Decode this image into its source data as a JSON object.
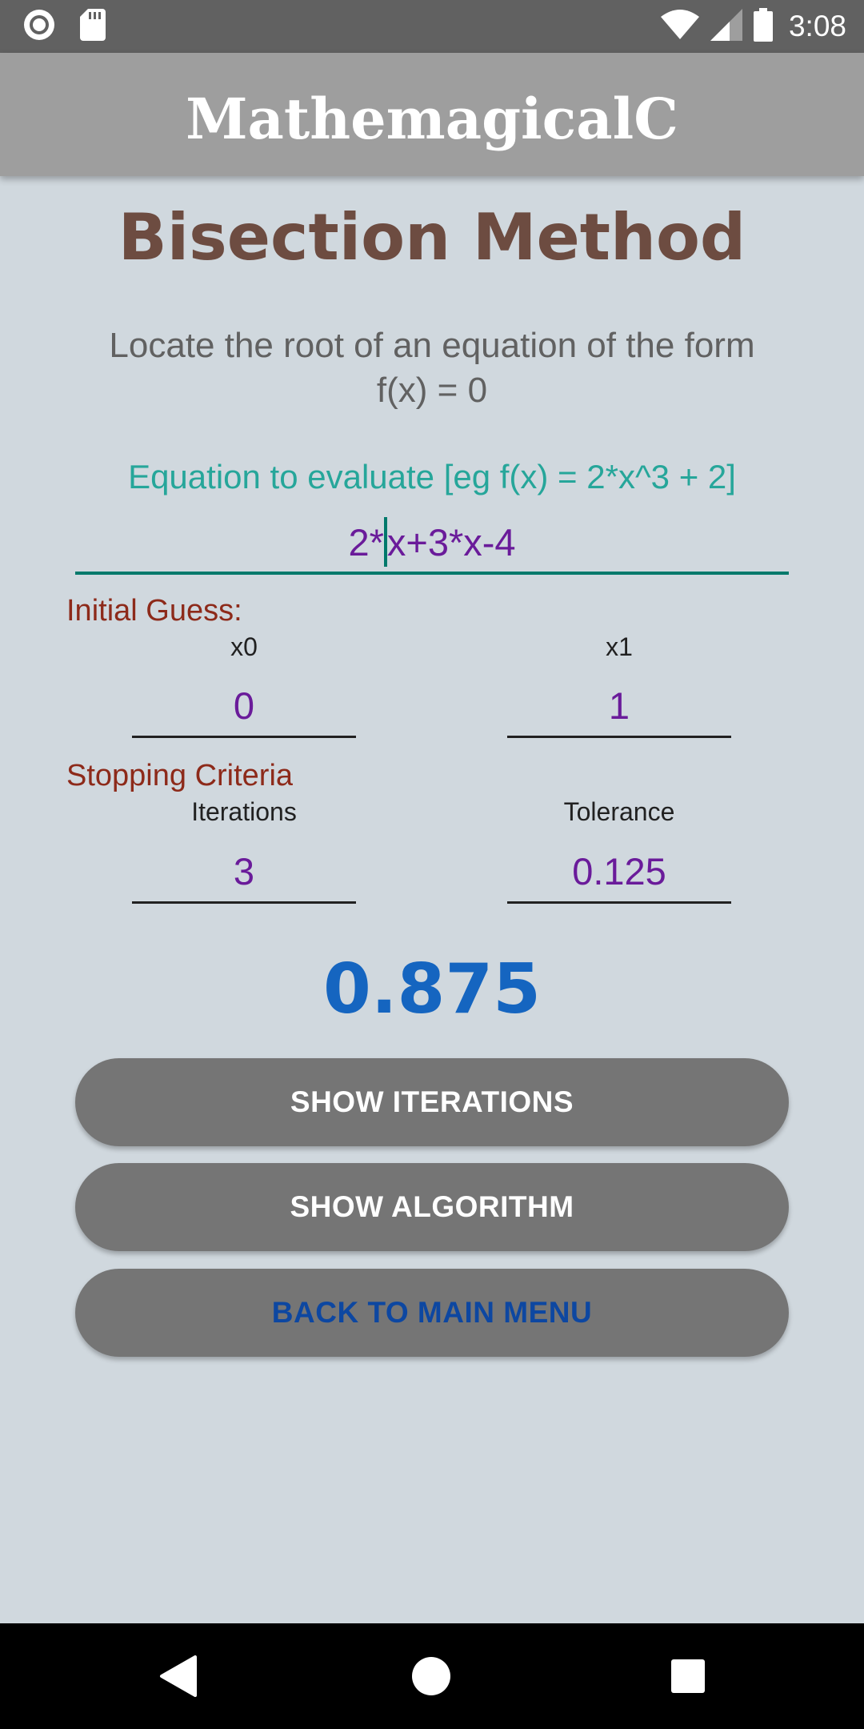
{
  "status_bar": {
    "time": "3:08",
    "icons": [
      "record-icon",
      "sd-card-icon",
      "wifi-icon",
      "signal-icon",
      "battery-icon"
    ]
  },
  "app_bar": {
    "title": "MathemagicalC"
  },
  "main": {
    "title": "Bisection Method",
    "subtitle": "Locate the root of an equation of the form f(x) = 0",
    "equation_label": "Equation to evaluate [eg f(x) = 2*x^3 + 2]",
    "equation_before_cursor": "2*",
    "equation_after_cursor": "x+3*x-4"
  },
  "initial_guess": {
    "label": "Initial Guess:",
    "x0_label": "x0",
    "x0_value": "0",
    "x1_label": "x1",
    "x1_value": "1"
  },
  "stopping": {
    "label": "Stopping Criteria",
    "iterations_label": "Iterations",
    "iterations_value": "3",
    "tolerance_label": "Tolerance",
    "tolerance_value": "0.125"
  },
  "result": {
    "value": "0.875"
  },
  "buttons": {
    "show_iterations": "SHOW ITERATIONS",
    "show_algorithm": "SHOW ALGORITHM",
    "back_to_main_menu": "BACK TO MAIN MENU"
  },
  "nav_bar": {
    "icons": [
      "back-icon",
      "home-icon",
      "recents-icon"
    ]
  },
  "colors": {
    "background": "#d0d8de",
    "app_bar": "#9e9e9e",
    "status_bar": "#616161",
    "title": "#6d4c41",
    "equation_label": "#26a69a",
    "input_text": "#6a1b9a",
    "section_label": "#8d2a1a",
    "result": "#1565c0",
    "button": "#757575",
    "back_button_text": "#0d47a1"
  }
}
